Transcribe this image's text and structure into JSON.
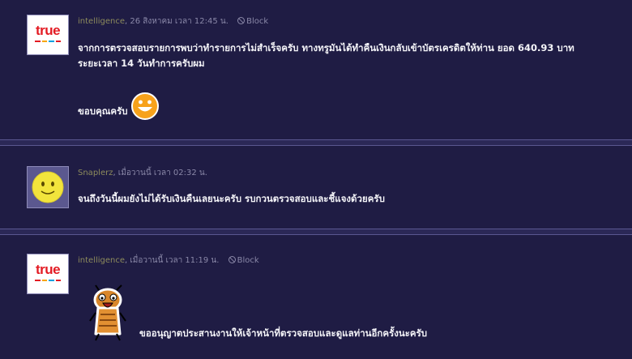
{
  "posts": [
    {
      "author": "intelligence",
      "date": ", 26 สิงหาคม เวลา 12:45 น.",
      "block": "Block",
      "avatar_text": "true",
      "line1": "จากการตรวจสอบรายการพบว่าทำรายการไม่สำเร็จครับ ทางทรูมันได้ทำคืนเงินกลับเข้าบัตรเครดิตให้ท่าน ยอด 640.93 บาท",
      "line2": "ระยะเวลา 14 วันทำการครับผม",
      "line3": "ขอบคุณครับ"
    },
    {
      "author": "Snaplerz",
      "date": ", เมื่อวานนี้ เวลา 02:32 น.",
      "line1": "จนถึงวันนี้ผมยังไม่ได้รับเงินคืนเลยนะครับ รบกวนตรวจสอบและชี้แจงด้วยครับ"
    },
    {
      "author": "intelligence",
      "date": ", เมื่อวานนี้ เวลา 11:19 น.",
      "block": "Block",
      "avatar_text": "true",
      "line1": "ขออนุญาตประสานงานให้เจ้าหน้าที่ตรวจสอบและดูแลท่านอีกครั้งนะครับ"
    }
  ],
  "colors": {
    "background": "#1f1c44",
    "separator": "#2b2857",
    "author": "#8d8b5c",
    "true_red": "#e31b23"
  },
  "icons": [
    "block-icon",
    "smile-emoticon-icon",
    "true-logo",
    "smiley-avatar-icon",
    "cartoon-sticker-icon"
  ]
}
